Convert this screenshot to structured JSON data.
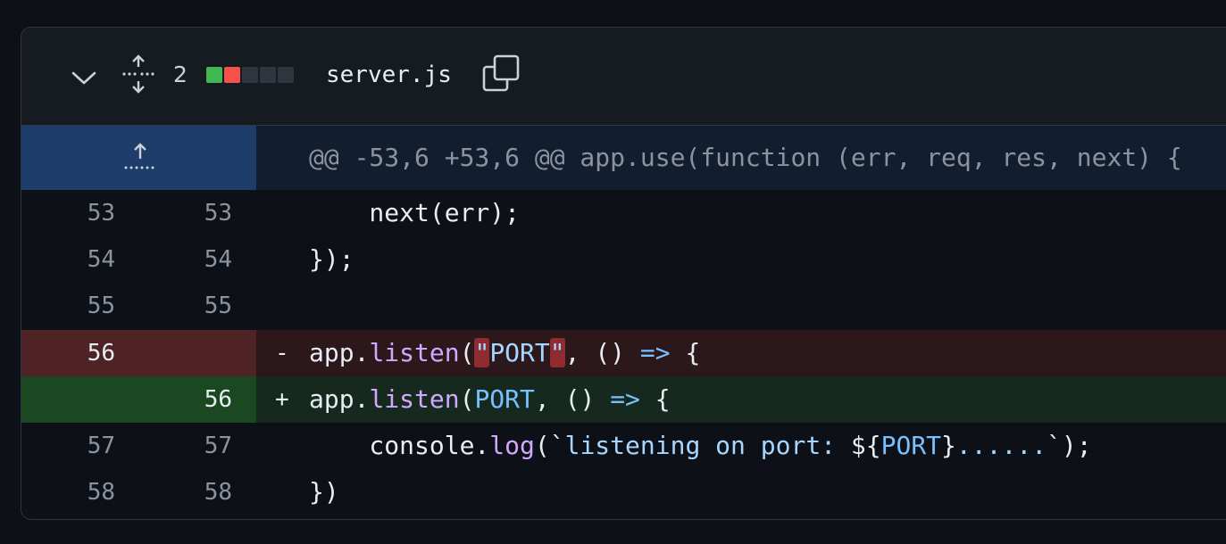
{
  "file": {
    "change_count": "2",
    "name": "server.js",
    "diffstat": [
      "#3fb950",
      "#f85149",
      "#30363d",
      "#30363d",
      "#30363d"
    ],
    "icons": [
      "chevron-down-icon",
      "expand-all-icon",
      "copy-icon"
    ]
  },
  "hunk": {
    "header": "@@ -53,6 +53,6 @@ app.use(function (err, req, res, next) {",
    "icon": "expand-up-icon"
  },
  "lines": [
    {
      "old": "53",
      "new": "53",
      "type": "context",
      "text": "    next(err);"
    },
    {
      "old": "54",
      "new": "54",
      "type": "context",
      "text": "});"
    },
    {
      "old": "55",
      "new": "55",
      "type": "context",
      "text": ""
    },
    {
      "old": "56",
      "new": "",
      "type": "deletion",
      "sign": "-",
      "parts": [
        "app.",
        "listen",
        "(",
        "\"",
        "PORT",
        "\"",
        ", () ",
        "=>",
        " {"
      ]
    },
    {
      "old": "",
      "new": "56",
      "type": "addition",
      "sign": "+",
      "parts": [
        "app.",
        "listen",
        "(",
        "PORT",
        ", () ",
        "=>",
        " {"
      ]
    },
    {
      "old": "57",
      "new": "57",
      "type": "context",
      "parts": [
        "    console.",
        "log",
        "(`",
        "listening on port: ",
        "${",
        "PORT",
        "}",
        "......",
        "`",
        ");"
      ]
    },
    {
      "old": "58",
      "new": "58",
      "type": "context",
      "text": "})"
    }
  ],
  "colors": {
    "addition_gutter": "#1b4721",
    "deletion_gutter": "#4f2325",
    "hunk_gutter": "#1f3d6a"
  }
}
